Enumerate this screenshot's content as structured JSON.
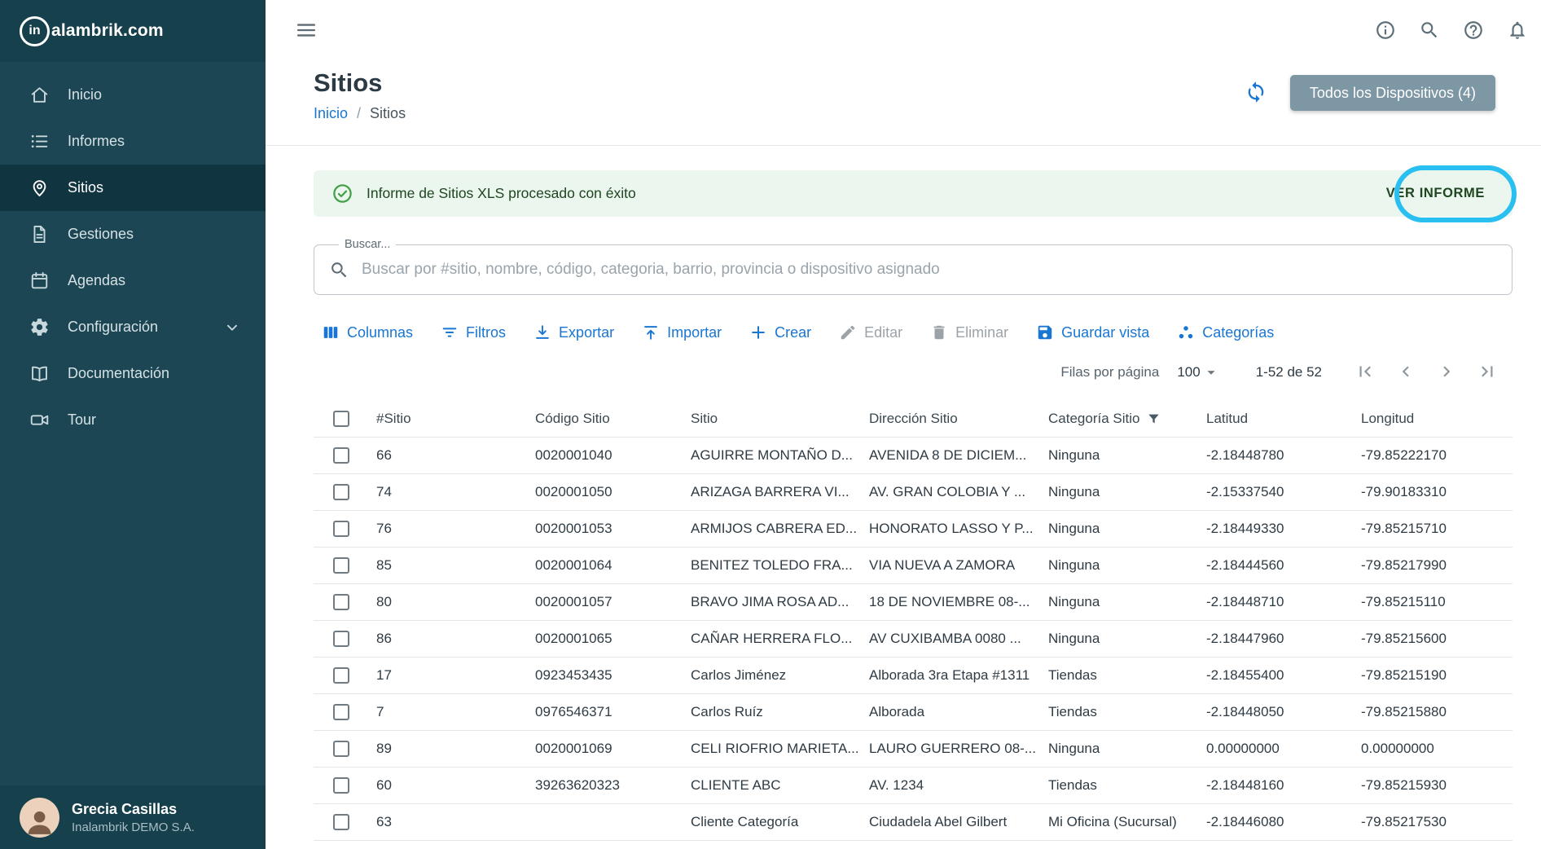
{
  "brand": {
    "circle_text": "in",
    "name_rest": "alambrik.com"
  },
  "sidebar": {
    "items": [
      {
        "label": "Inicio",
        "icon": "home-icon",
        "selected": false,
        "expandable": false
      },
      {
        "label": "Informes",
        "icon": "informes-icon",
        "selected": false,
        "expandable": false
      },
      {
        "label": "Sitios",
        "icon": "pin-icon",
        "selected": true,
        "expandable": false
      },
      {
        "label": "Gestiones",
        "icon": "file-icon",
        "selected": false,
        "expandable": false
      },
      {
        "label": "Agendas",
        "icon": "calendar-icon",
        "selected": false,
        "expandable": false
      },
      {
        "label": "Configuración",
        "icon": "gear-icon",
        "selected": false,
        "expandable": true
      },
      {
        "label": "Documentación",
        "icon": "book-icon",
        "selected": false,
        "expandable": false
      },
      {
        "label": "Tour",
        "icon": "video-icon",
        "selected": false,
        "expandable": false
      }
    ],
    "user": {
      "name": "Grecia Casillas",
      "company": "Inalambrik DEMO S.A."
    }
  },
  "page": {
    "title": "Sitios",
    "breadcrumb": {
      "link": "Inicio",
      "separator": "/",
      "current": "Sitios"
    },
    "devices_button": "Todos los Dispositivos (4)"
  },
  "alert": {
    "message": "Informe de Sitios XLS procesado con éxito",
    "action": "VER INFORME"
  },
  "search": {
    "label": "Buscar...",
    "placeholder": "Buscar por #sitio, nombre, código, categoria, barrio, provincia o dispositivo asignado",
    "value": ""
  },
  "toolbar": [
    {
      "label": "Columnas",
      "icon": "columns-icon",
      "disabled": false
    },
    {
      "label": "Filtros",
      "icon": "filter-icon",
      "disabled": false
    },
    {
      "label": "Exportar",
      "icon": "download-icon",
      "disabled": false
    },
    {
      "label": "Importar",
      "icon": "upload-icon",
      "disabled": false
    },
    {
      "label": "Crear",
      "icon": "plus-icon",
      "disabled": false
    },
    {
      "label": "Editar",
      "icon": "pencil-icon",
      "disabled": true
    },
    {
      "label": "Eliminar",
      "icon": "trash-icon",
      "disabled": true
    },
    {
      "label": "Guardar vista",
      "icon": "save-icon",
      "disabled": false
    },
    {
      "label": "Categorías",
      "icon": "categories-icon",
      "disabled": false
    }
  ],
  "pagination": {
    "rows_per_page_label": "Filas por página",
    "rows_per_page": "100",
    "range": "1-52 de 52"
  },
  "table": {
    "headers": [
      "#Sitio",
      "Código Sitio",
      "Sitio",
      "Dirección Sitio",
      "Categoría Sitio",
      "Latitud",
      "Longitud"
    ],
    "rows": [
      {
        "num": "66",
        "code": "0020001040",
        "name": "AGUIRRE MONTAÑO D...",
        "address": "AVENIDA 8 DE DICIEM...",
        "category": "Ninguna",
        "lat": "-2.18448780",
        "lng": "-79.85222170"
      },
      {
        "num": "74",
        "code": "0020001050",
        "name": "ARIZAGA BARRERA VI...",
        "address": "AV. GRAN COLOBIA Y ...",
        "category": "Ninguna",
        "lat": "-2.15337540",
        "lng": "-79.90183310"
      },
      {
        "num": "76",
        "code": "0020001053",
        "name": "ARMIJOS CABRERA ED...",
        "address": "HONORATO LASSO Y P...",
        "category": "Ninguna",
        "lat": "-2.18449330",
        "lng": "-79.85215710"
      },
      {
        "num": "85",
        "code": "0020001064",
        "name": "BENITEZ TOLEDO FRA...",
        "address": "VIA NUEVA A ZAMORA",
        "category": "Ninguna",
        "lat": "-2.18444560",
        "lng": "-79.85217990"
      },
      {
        "num": "80",
        "code": "0020001057",
        "name": "BRAVO JIMA ROSA AD...",
        "address": "18 DE NOVIEMBRE 08-...",
        "category": "Ninguna",
        "lat": "-2.18448710",
        "lng": "-79.85215110"
      },
      {
        "num": "86",
        "code": "0020001065",
        "name": "CAÑAR HERRERA FLO...",
        "address": "AV CUXIBAMBA 0080 ...",
        "category": "Ninguna",
        "lat": "-2.18447960",
        "lng": "-79.85215600"
      },
      {
        "num": "17",
        "code": "0923453435",
        "name": "Carlos Jiménez",
        "address": "Alborada 3ra Etapa #1311",
        "category": "Tiendas",
        "lat": "-2.18455400",
        "lng": "-79.85215190"
      },
      {
        "num": "7",
        "code": "0976546371",
        "name": "Carlos Ruíz",
        "address": "Alborada",
        "category": "Tiendas",
        "lat": "-2.18448050",
        "lng": "-79.85215880"
      },
      {
        "num": "89",
        "code": "0020001069",
        "name": "CELI RIOFRIO MARIETA...",
        "address": "LAURO GUERRERO 08-...",
        "category": "Ninguna",
        "lat": "0.00000000",
        "lng": "0.00000000"
      },
      {
        "num": "60",
        "code": "39263620323",
        "name": "CLIENTE ABC",
        "address": "AV. 1234",
        "category": "Tiendas",
        "lat": "-2.18448160",
        "lng": "-79.85215930"
      },
      {
        "num": "63",
        "code": "",
        "name": "Cliente Categoría",
        "address": "Ciudadela Abel Gilbert",
        "category": "Mi Oficina (Sucursal)",
        "lat": "-2.18446080",
        "lng": "-79.85217530"
      }
    ]
  },
  "colors": {
    "sidebar_bg": "#1c4653",
    "sidebar_selected": "#113441",
    "accent_blue": "#1976d2",
    "success_green": "#43a047",
    "alert_bg": "#ebf6ee",
    "devices_button_bg": "#7d97a4",
    "highlight_cyan": "#29bff0"
  }
}
